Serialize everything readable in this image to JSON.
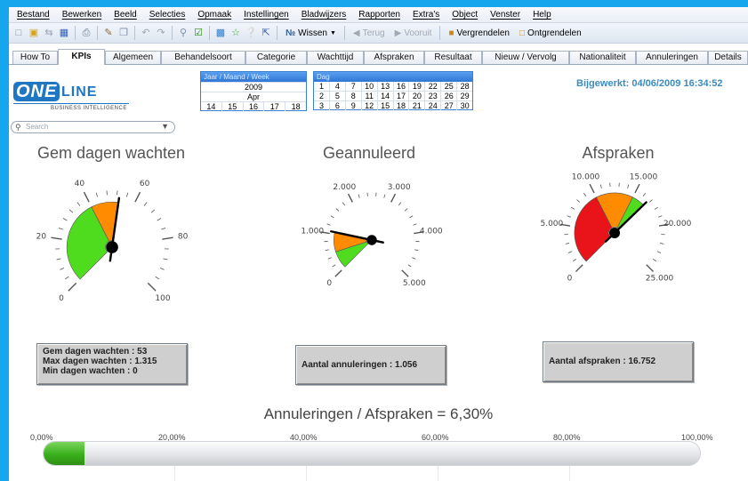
{
  "menu": [
    "Bestand",
    "Bewerken",
    "Beeld",
    "Selecties",
    "Opmaak",
    "Instellingen",
    "Bladwijzers",
    "Rapporten",
    "Extra's",
    "Object",
    "Venster",
    "Help"
  ],
  "toolbar": {
    "wissen": "Wissen",
    "terug": "Terug",
    "vooruit": "Vooruit",
    "vergrendelen": "Vergrendelen",
    "ontgrendelen": "Ontgrendelen"
  },
  "tabs": [
    "How To",
    "KPIs",
    "Algemeen",
    "Behandelsoort",
    "Categorie",
    "Wachttijd",
    "Afspraken",
    "Resultaat",
    "Nieuw / Vervolg",
    "Nationaliteit",
    "Annuleringen",
    "Details"
  ],
  "active_tab": "KPIs",
  "logo": {
    "one": "ONE",
    "line": "LINE",
    "subtitle": "BUSINESS INTELLIGENCE"
  },
  "search": {
    "placeholder": "Search"
  },
  "period": {
    "header": "Jaar / Maand / Week",
    "year": "2009",
    "month": "Apr",
    "weeks": [
      "14",
      "15",
      "16",
      "17",
      "18"
    ]
  },
  "day": {
    "header": "Dag",
    "rows": [
      [
        "1",
        "4",
        "7",
        "10",
        "13",
        "16",
        "19",
        "22",
        "25",
        "28"
      ],
      [
        "2",
        "5",
        "8",
        "11",
        "14",
        "17",
        "20",
        "23",
        "26",
        "29"
      ],
      [
        "3",
        "6",
        "9",
        "12",
        "15",
        "18",
        "21",
        "24",
        "27",
        "30"
      ]
    ]
  },
  "updated": "Bijgewerkt: 04/06/2009 16:34:52",
  "gauges": [
    {
      "title": "Gem dagen wachten",
      "labels": [
        "0",
        "20",
        "40",
        "60",
        "80",
        "100"
      ],
      "min": 0,
      "max": 100,
      "value": 53,
      "bands": [
        {
          "from": 0,
          "to": 40,
          "color": "#4fdc1f"
        },
        {
          "from": 40,
          "to": 53,
          "color": "#ff8c00"
        }
      ]
    },
    {
      "title": "Geannuleerd",
      "labels": [
        "0",
        "1.000",
        "2.000",
        "3.000",
        "4.000",
        "5.000"
      ],
      "min": 0,
      "max": 5000,
      "value": 1056,
      "bands": [
        {
          "from": 0,
          "to": 500,
          "color": "#4fdc1f"
        },
        {
          "from": 500,
          "to": 1056,
          "color": "#ff8c00"
        }
      ]
    },
    {
      "title": "Afspraken",
      "labels": [
        "0",
        "5.000",
        "10.000",
        "15.000",
        "20.000",
        "25.000"
      ],
      "min": 0,
      "max": 25000,
      "value": 16752,
      "bands": [
        {
          "from": 0,
          "to": 10000,
          "color": "#e8141a"
        },
        {
          "from": 10000,
          "to": 15000,
          "color": "#ff8c00"
        },
        {
          "from": 15000,
          "to": 16752,
          "color": "#4fdc1f"
        }
      ]
    }
  ],
  "info": {
    "wachten": [
      "Gem dagen wachten : 53",
      "Max dagen wachten : 1.315",
      "Min dagen wachten  : 0"
    ],
    "annuleringen": "Aantal annuleringen : 1.056",
    "afspraken": "Aantal afspraken : 16.752"
  },
  "ratio": {
    "label": "Annuleringen / Afspraken = 6,30%",
    "value": 6.3,
    "scale": [
      "0,00%",
      "20,00%",
      "40,00%",
      "60,00%",
      "80,00%",
      "100,00%"
    ]
  }
}
